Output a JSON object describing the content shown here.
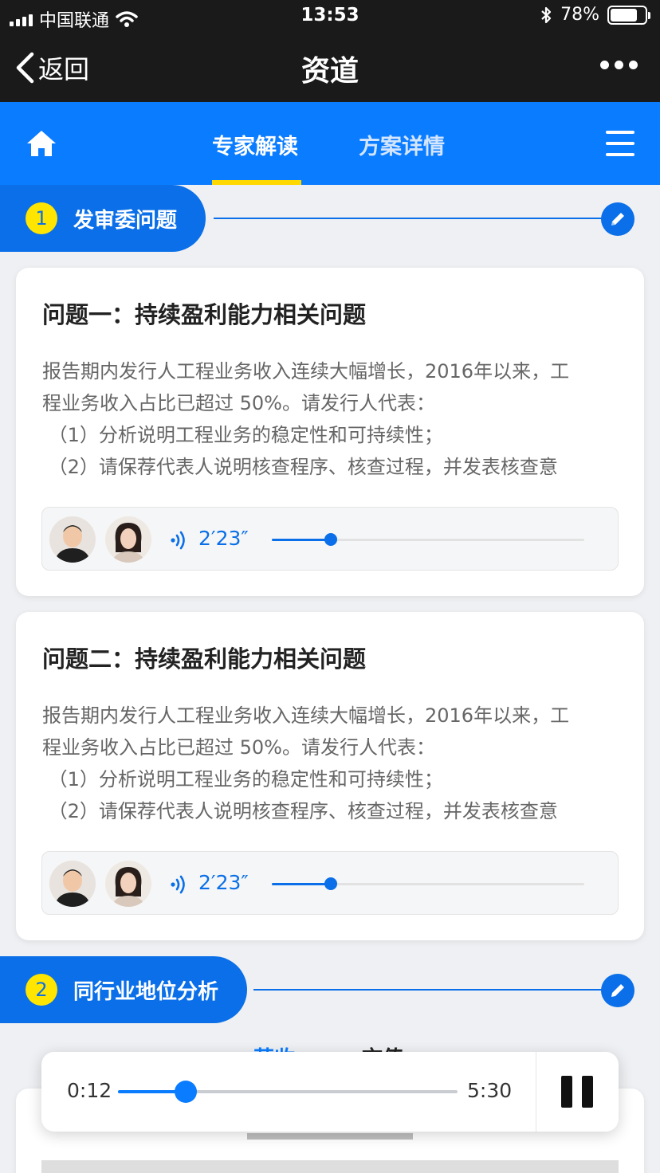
{
  "status_bar": {
    "carrier": "中国联通",
    "time": "13:53",
    "battery": "78%",
    "battery_level": 0.78
  },
  "nav": {
    "back_label": "返回",
    "title": "资道"
  },
  "tabs": {
    "items": [
      {
        "label": "专家解读",
        "active": true
      },
      {
        "label": "方案详情",
        "active": false
      }
    ]
  },
  "sections": [
    {
      "number": "1",
      "title": "发审委问题"
    },
    {
      "number": "2",
      "title": "同行业地位分析"
    }
  ],
  "questions": [
    {
      "title": "问题一：持续盈利能力相关问题",
      "body": "报告期内发行人工程业务收入连续大幅增长，2016年以来，工\n程业务收入占比已超过 50%。请发行人代表：\n （1）分析说明工程业务的稳定性和可持续性；\n （2）请保荐代表人说明核查程序、核查过程，并发表核查意",
      "audio": {
        "duration": "2′23″",
        "progress": 0.19
      }
    },
    {
      "title": "问题二：持续盈利能力相关问题",
      "body": "报告期内发行人工程业务收入连续大幅增长，2016年以来，工\n程业务收入占比已超过 50%。请发行人代表：\n （1）分析说明工程业务的稳定性和可持续性；\n （2）请保荐代表人说明核查程序、核查过程，并发表核查意",
      "audio": {
        "duration": "2′23″",
        "progress": 0.19
      }
    }
  ],
  "sub_tabs": [
    "营收",
    "市值"
  ],
  "player": {
    "elapsed": "0:12",
    "total": "5:30",
    "progress": 0.2,
    "state": "playing"
  },
  "colors": {
    "brand_blue": "#0a7cff",
    "section_blue": "#0a6fe8",
    "indicator_yellow": "#ffd800"
  }
}
